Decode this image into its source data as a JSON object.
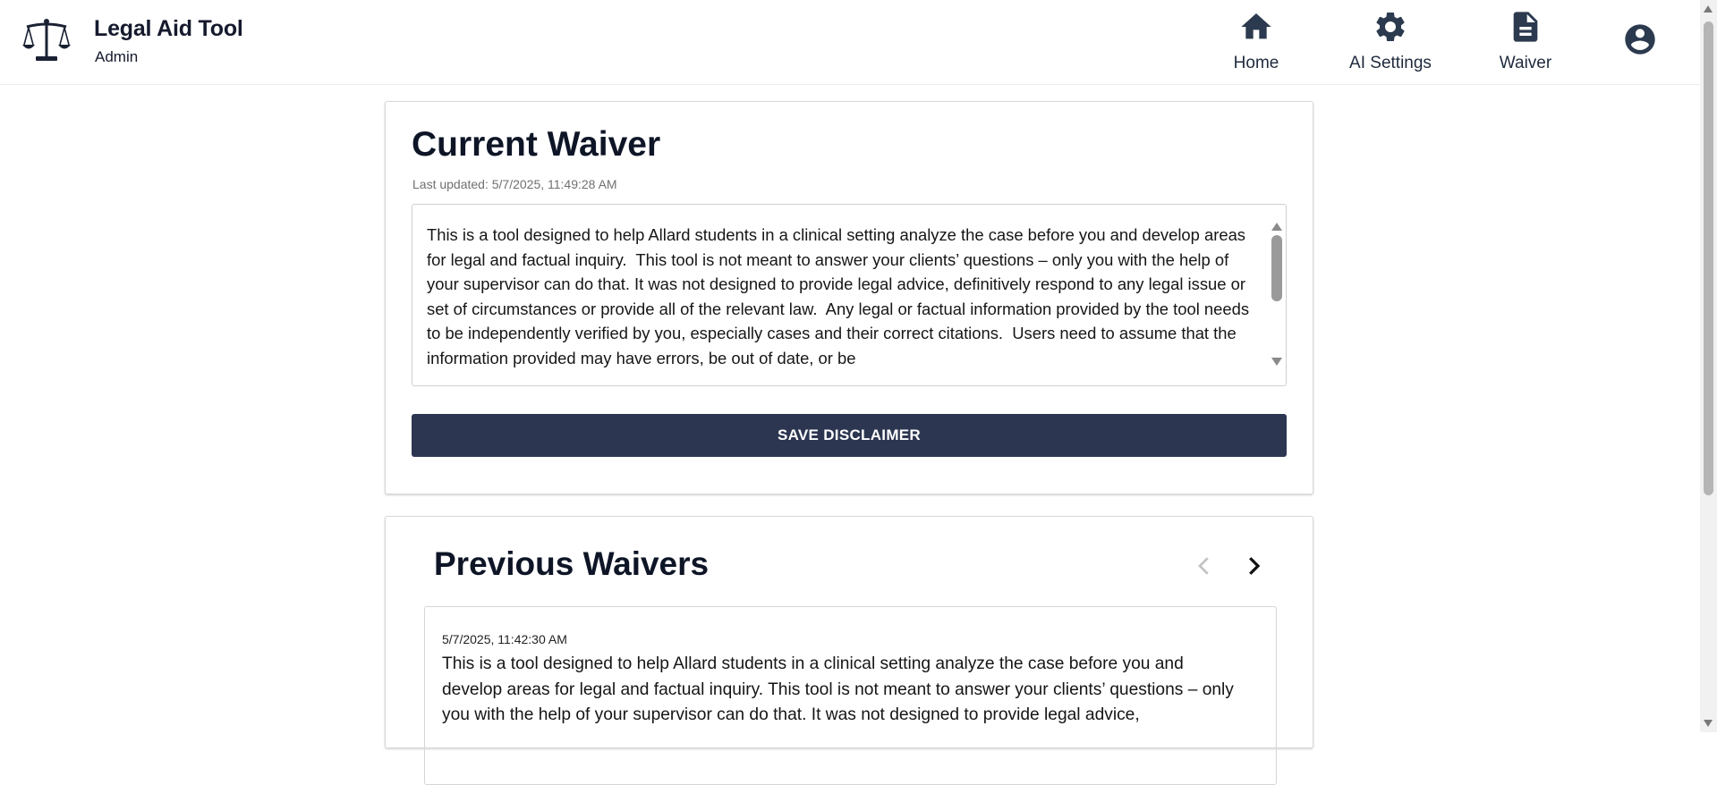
{
  "header": {
    "logo_icon": "scales-of-justice-icon",
    "title": "Legal Aid Tool",
    "role": "Admin",
    "nav": [
      {
        "label": "Home",
        "icon": "home-icon"
      },
      {
        "label": "AI Settings",
        "icon": "gear-icon"
      },
      {
        "label": "Waiver",
        "icon": "document-icon"
      }
    ],
    "account_icon": "account-circle-icon"
  },
  "current_waiver": {
    "title": "Current Waiver",
    "last_updated": "Last updated: 5/7/2025, 11:49:28 AM",
    "text": "This is a tool designed to help Allard students in a clinical setting analyze the case before you and develop areas for legal and factual inquiry.  This tool is not meant to answer your clients’ questions – only you with the help of your supervisor can do that. It was not designed to provide legal advice, definitively respond to any legal issue or set of circumstances or provide all of the relevant law.  Any legal or factual information provided by the tool needs to be independently verified by you, especially cases and their correct citations.  Users need to assume that the information provided may have errors, be out of date, or be",
    "save_label": "SAVE DISCLAIMER"
  },
  "previous_waivers": {
    "title": "Previous Waivers",
    "prev_icon": "chevron-left-icon",
    "next_icon": "chevron-right-icon",
    "entries": [
      {
        "date": "5/7/2025, 11:42:30 AM",
        "text": "This is a tool designed to help Allard students in a clinical setting analyze the case before you and develop areas for legal and factual inquiry.  This tool is not meant to answer your clients’ questions – only you with the help of your supervisor can do that. It was not designed to provide legal advice,"
      }
    ]
  },
  "colors": {
    "primary_button": "#2c3651",
    "nav_icon": "#2b3a4e",
    "heading": "#0e1526"
  }
}
